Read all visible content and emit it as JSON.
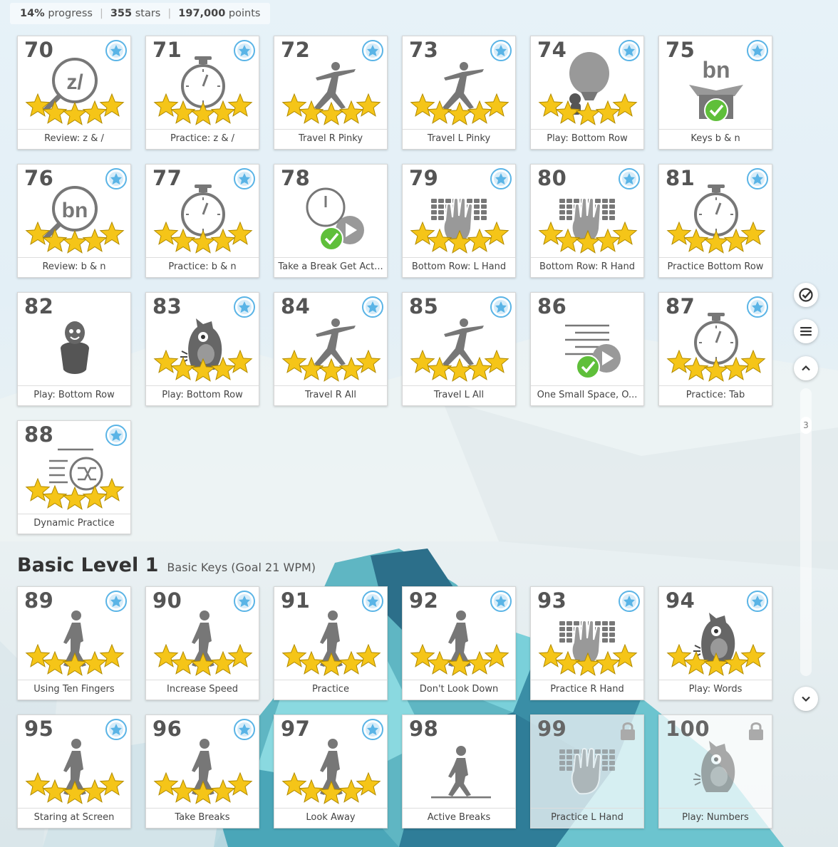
{
  "progress": {
    "percent_value": "14%",
    "percent_label": "progress",
    "stars_value": "355",
    "stars_label": "stars",
    "points_value": "197,000",
    "points_label": "points"
  },
  "section": {
    "title": "Basic Level 1",
    "subtitle": "Basic Keys (Goal 21 WPM)"
  },
  "scroll": {
    "page_indicator": "3"
  },
  "lessons": [
    {
      "num": "70",
      "label": "Review: z & /",
      "icon": "magnifier-zslash-icon",
      "stars": 5,
      "badge": true
    },
    {
      "num": "71",
      "label": "Practice: z & /",
      "icon": "stopwatch-icon",
      "stars": 5,
      "badge": true
    },
    {
      "num": "72",
      "label": "Travel R Pinky",
      "icon": "yoga-pose-icon",
      "stars": 5,
      "badge": true
    },
    {
      "num": "73",
      "label": "Travel L Pinky",
      "icon": "yoga-pose-icon",
      "stars": 5,
      "badge": true
    },
    {
      "num": "74",
      "label": "Play: Bottom Row",
      "icon": "balloon-game-icon",
      "stars": 5,
      "badge": true
    },
    {
      "num": "75",
      "label": "Keys b & n",
      "icon": "box-bn-icon",
      "stars": 0,
      "badge": true,
      "done": true
    },
    {
      "num": "76",
      "label": "Review: b & n",
      "icon": "magnifier-bn-icon",
      "stars": 5,
      "badge": true
    },
    {
      "num": "77",
      "label": "Practice: b & n",
      "icon": "stopwatch-icon",
      "stars": 5,
      "badge": true
    },
    {
      "num": "78",
      "label": "Take a Break Get Act...",
      "icon": "break-video-icon",
      "stars": 0,
      "badge": false,
      "done": true
    },
    {
      "num": "79",
      "label": "Bottom Row: L Hand",
      "icon": "keyboard-hand-icon",
      "stars": 5,
      "badge": true
    },
    {
      "num": "80",
      "label": "Bottom Row: R Hand",
      "icon": "keyboard-hand-icon",
      "stars": 5,
      "badge": true
    },
    {
      "num": "81",
      "label": "Practice Bottom Row",
      "icon": "stopwatch-icon",
      "stars": 5,
      "badge": true
    },
    {
      "num": "82",
      "label": "Play: Bottom Row",
      "icon": "monster-pot-icon",
      "stars": 0,
      "badge": false
    },
    {
      "num": "83",
      "label": "Play: Bottom Row",
      "icon": "monster-game-icon",
      "stars": 5,
      "badge": true
    },
    {
      "num": "84",
      "label": "Travel R All",
      "icon": "yoga-pose-icon",
      "stars": 5,
      "badge": true
    },
    {
      "num": "85",
      "label": "Travel L All",
      "icon": "yoga-pose-icon",
      "stars": 5,
      "badge": true
    },
    {
      "num": "86",
      "label": "One Small Space, O...",
      "icon": "indent-video-icon",
      "stars": 0,
      "badge": false,
      "done": true
    },
    {
      "num": "87",
      "label": "Practice: Tab",
      "icon": "stopwatch-icon",
      "stars": 5,
      "badge": true
    },
    {
      "num": "88",
      "label": "Dynamic Practice",
      "icon": "shuffle-list-icon",
      "stars": 5,
      "badge": true
    }
  ],
  "basic_lessons": [
    {
      "num": "89",
      "label": "Using Ten Fingers",
      "icon": "walking-person-icon",
      "stars": 5,
      "badge": true
    },
    {
      "num": "90",
      "label": "Increase Speed",
      "icon": "walking-person-icon",
      "stars": 5,
      "badge": true
    },
    {
      "num": "91",
      "label": "Practice",
      "icon": "walking-person-icon",
      "stars": 5,
      "badge": true
    },
    {
      "num": "92",
      "label": "Don't Look Down",
      "icon": "walking-person-icon",
      "stars": 5,
      "badge": true
    },
    {
      "num": "93",
      "label": "Practice R Hand",
      "icon": "keyboard-hand-icon",
      "stars": 5,
      "badge": true
    },
    {
      "num": "94",
      "label": "Play: Words",
      "icon": "monster-game-icon",
      "stars": 5,
      "badge": true
    },
    {
      "num": "95",
      "label": "Staring at Screen",
      "icon": "walking-person-icon",
      "stars": 5,
      "badge": true
    },
    {
      "num": "96",
      "label": "Take Breaks",
      "icon": "walking-person-icon",
      "stars": 5,
      "badge": true
    },
    {
      "num": "97",
      "label": "Look Away",
      "icon": "walking-person-icon",
      "stars": 5,
      "badge": true
    },
    {
      "num": "98",
      "label": "Active Breaks",
      "icon": "walking-floor-icon",
      "stars": 0,
      "badge": false
    },
    {
      "num": "99",
      "label": "Practice L Hand",
      "icon": "keyboard-hand-icon",
      "stars": 0,
      "badge": false,
      "locked": true
    },
    {
      "num": "100",
      "label": "Play: Numbers",
      "icon": "monster-game-icon",
      "stars": 0,
      "badge": false,
      "locked": true
    }
  ],
  "colors": {
    "star": "#f5c518",
    "badge": "#5ab4e6",
    "check": "#5fbf3a",
    "icon_gray": "#777777"
  }
}
